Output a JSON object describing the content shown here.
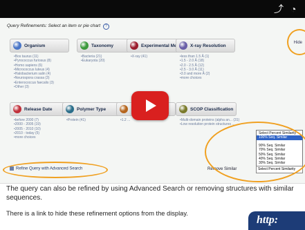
{
  "topbar": {
    "share_icon": "share-icon",
    "clock_icon": "clock-icon"
  },
  "query_refinements": {
    "header": "Query Refinements: Select an item or pie chart",
    "help_icon": "?",
    "hide_link": "Hide",
    "categories": [
      {
        "label": "Organism",
        "color": "#4a76c7",
        "items": [
          "Bos taurus (11)",
          "Pyrococcus furiosus (8)",
          "Homo sapiens (6)",
          "Micrococcus luteus (4)",
          "Halobacterium salin (4)",
          "Neurospora crassa (3)",
          "Enterococcus faecalis (3)",
          "Other (3)"
        ]
      },
      {
        "label": "Taxonomy",
        "color": "#3c9a3c",
        "items": [
          "Bacteria (21)",
          "Eukaryota (20)"
        ]
      },
      {
        "label": "Experimental Method",
        "color": "#9a1c2c",
        "items": [
          "X-ray (41)"
        ]
      },
      {
        "label": "X-ray Resolution",
        "color": "#6a5fa8",
        "items": [
          "less than 1.5 Å (1)",
          "1.5 - 2.0 Å (18)",
          "2.0 - 2.5 Å (12)",
          "2.5 - 3.0 Å (11)",
          "3.0 and more Å (2)",
          "more choices"
        ]
      },
      {
        "label": "Release Date",
        "color": "#c0303a",
        "items": [
          "before 2000 (7)",
          "2000 - 2005 (19)",
          "2005 - 2010 (10)",
          "2010 - today (5)",
          "more choices"
        ]
      },
      {
        "label": "Polymer Type",
        "color": "#2a6e8a",
        "items": [
          "Protein (41)"
        ]
      },
      {
        "label": "",
        "color": "#b5651d",
        "items": [
          "1.2 ..."
        ]
      },
      {
        "label": "SCOP Classification",
        "color": "#7a7a2a",
        "items": [
          "Multi-domain proteins (alpha an... (31)",
          "Low resolution protein structures ..."
        ]
      }
    ],
    "refine_advanced": "Refine Query with Advanced Search",
    "remove_similar": "Remove Similar",
    "dropdown": {
      "options": [
        "Select Percent Similarity",
        "100% Seq. Similar",
        "",
        "90% Seq. Similar",
        "70% Seq. Similar",
        "50% Seq. Similar",
        "40% Seq. Similar",
        "30% Seq. Similar"
      ],
      "selected_index": 1,
      "current_value": "Select Percent Similarity"
    }
  },
  "video": {
    "play_icon": "play-icon"
  },
  "caption": {
    "line1": "The query can also be refined by using Advanced Search or removing structures with similar sequences.",
    "line2": "There is a link to hide these refinement options from the display."
  },
  "url_badge": {
    "text": "http:"
  },
  "colors": {
    "highlight": "#f0a020",
    "play_button": "#d9201f",
    "badge": "#1d3c77"
  }
}
